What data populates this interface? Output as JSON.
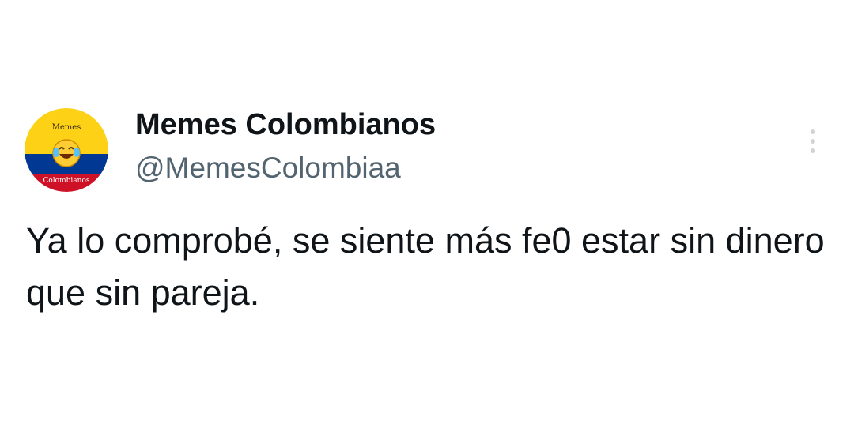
{
  "tweet": {
    "author": {
      "display_name": "Memes Colombianos",
      "handle": "@MemesColombiaa",
      "avatar": {
        "top_text": "Memes",
        "bottom_text": "Colombianos",
        "emoji": "😂",
        "colors": {
          "yellow": "#FCD116",
          "blue": "#003893",
          "red": "#CE1126"
        }
      }
    },
    "text": "Ya lo comprobé, se siente más fe0 estar sin dinero que sin pareja.",
    "more_icon": "more-vertical-icon"
  },
  "colors": {
    "text_primary": "#0f1419",
    "text_secondary": "#536471",
    "more_dots": "#cfd3d6"
  }
}
